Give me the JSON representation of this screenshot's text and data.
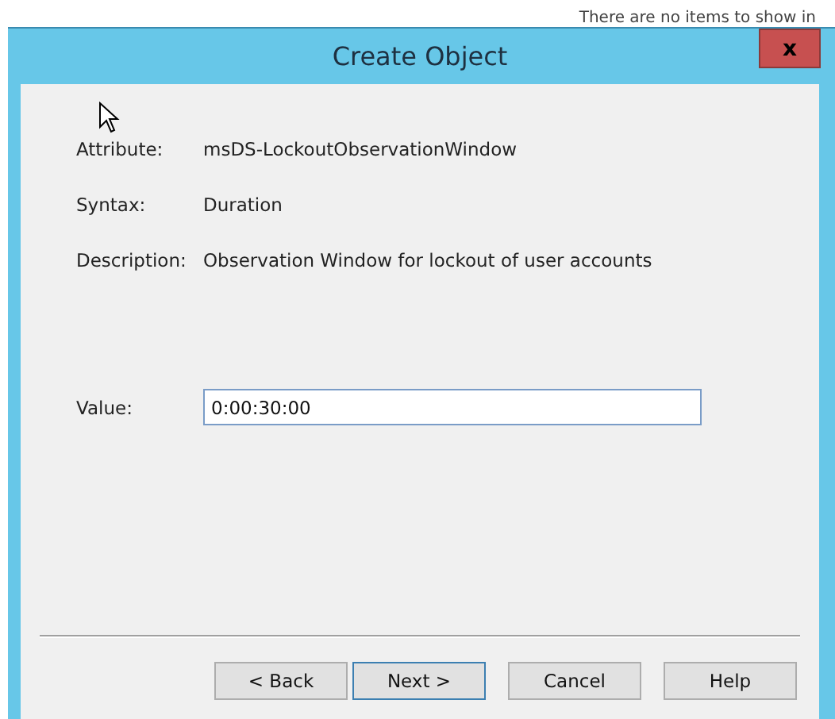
{
  "background": {
    "text": "There are no items to show in"
  },
  "window": {
    "title": "Create Object",
    "close": "x"
  },
  "fields": [
    {
      "label": "Attribute:",
      "value": "msDS-LockoutObservationWindow"
    },
    {
      "label": "Syntax:",
      "value": "Duration"
    },
    {
      "label": "Description:",
      "value": "Observation Window for lockout of user accounts"
    }
  ],
  "value_field": {
    "label": "Value:",
    "value": "0:00:30:00"
  },
  "buttons": [
    {
      "label": "< Back",
      "default": false
    },
    {
      "label": "Next >",
      "default": true
    },
    {
      "label": "Cancel",
      "default": false
    },
    {
      "label": "Help",
      "default": false
    }
  ]
}
